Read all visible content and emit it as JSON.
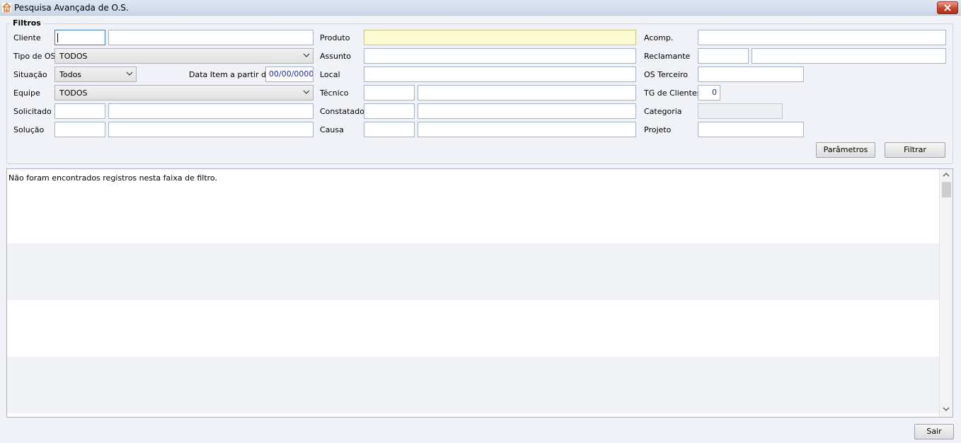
{
  "window": {
    "title": "Pesquisa Avançada de O.S.",
    "icon": "app-house-icon"
  },
  "filters": {
    "legend": "Filtros",
    "cliente": {
      "label": "Cliente",
      "code": "",
      "name": ""
    },
    "tipo_os": {
      "label": "Tipo de OS",
      "selected": "TODOS"
    },
    "situacao": {
      "label": "Situação",
      "selected": "Todos"
    },
    "data_item": {
      "label": "Data Item a partir de",
      "value": "00/00/0000"
    },
    "equipe": {
      "label": "Equipe",
      "selected": "TODOS"
    },
    "solicitado": {
      "label": "Solicitado",
      "code": "",
      "name": ""
    },
    "solucao": {
      "label": "Solução",
      "code": "",
      "name": ""
    },
    "produto": {
      "label": "Produto",
      "value": ""
    },
    "assunto": {
      "label": "Assunto",
      "value": ""
    },
    "local": {
      "label": "Local",
      "value": ""
    },
    "tecnico": {
      "label": "Técnico",
      "code": "",
      "name": ""
    },
    "constatado": {
      "label": "Constatado",
      "code": "",
      "name": ""
    },
    "causa": {
      "label": "Causa",
      "code": "",
      "name": ""
    },
    "acomp": {
      "label": "Acomp.",
      "value": ""
    },
    "reclamante": {
      "label": "Reclamante",
      "code": "",
      "name": ""
    },
    "os_terceiro": {
      "label": "OS Terceiro",
      "value": ""
    },
    "tg_clientes": {
      "label": "TG de Clientes",
      "value": "0"
    },
    "categoria": {
      "label": "Categoria",
      "value": ""
    },
    "projeto": {
      "label": "Projeto",
      "value": ""
    }
  },
  "buttons": {
    "parametros": "Parâmetros",
    "filtrar": "Filtrar",
    "sair": "Sair"
  },
  "results": {
    "empty_message": "Não foram encontrados registros nesta faixa de filtro."
  },
  "colors": {
    "highlight_field": "#fdfbd2",
    "value_text": "#1c2bb0",
    "close_button": "#c7432a"
  }
}
